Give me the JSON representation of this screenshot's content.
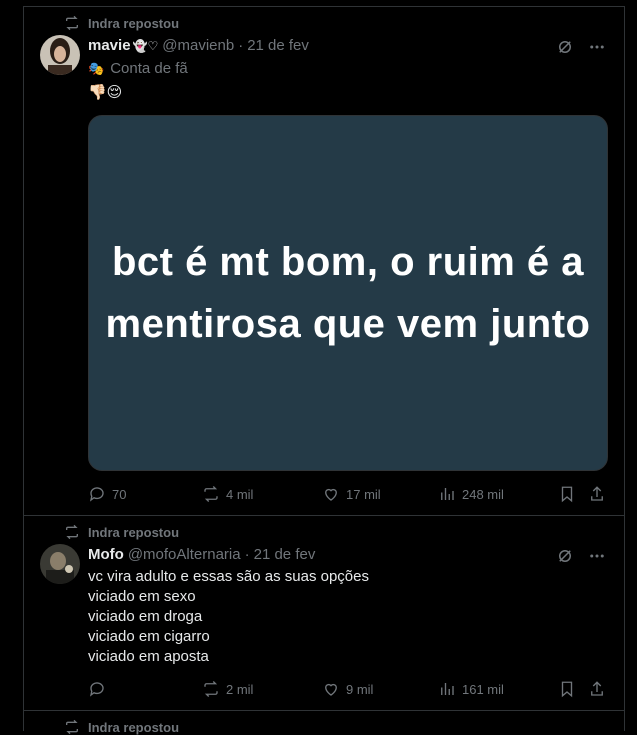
{
  "posts": [
    {
      "repost_label": "Indra repostou",
      "name": "mavie",
      "name_emoji": "👻♡",
      "handle": "@mavienb",
      "date": "21 de fev",
      "label_icon": "🎭",
      "label": "Conta de fã",
      "text": "👎🏻😌",
      "media_text": "bct é mt bom, o ruim é a mentirosa que vem junto",
      "replies": "70",
      "reposts": "4 mil",
      "likes": "17 mil",
      "views": "248 mil"
    },
    {
      "repost_label": "Indra repostou",
      "name": "Mofo",
      "handle": "@mofoAlternaria",
      "date": "21 de fev",
      "lines": [
        "vc vira adulto e essas são as suas opções",
        "viciado em sexo",
        "viciado em droga",
        "viciado em cigarro",
        "viciado em aposta"
      ],
      "reposts": "2 mil",
      "likes": "9 mil",
      "views": "161 mil"
    },
    {
      "repost_label": "Indra repostou"
    }
  ],
  "colors": {
    "background": "#000000",
    "text": "#e7e9ea",
    "muted": "#71767b",
    "border": "#2f3336",
    "media_bg": "#243a47"
  }
}
